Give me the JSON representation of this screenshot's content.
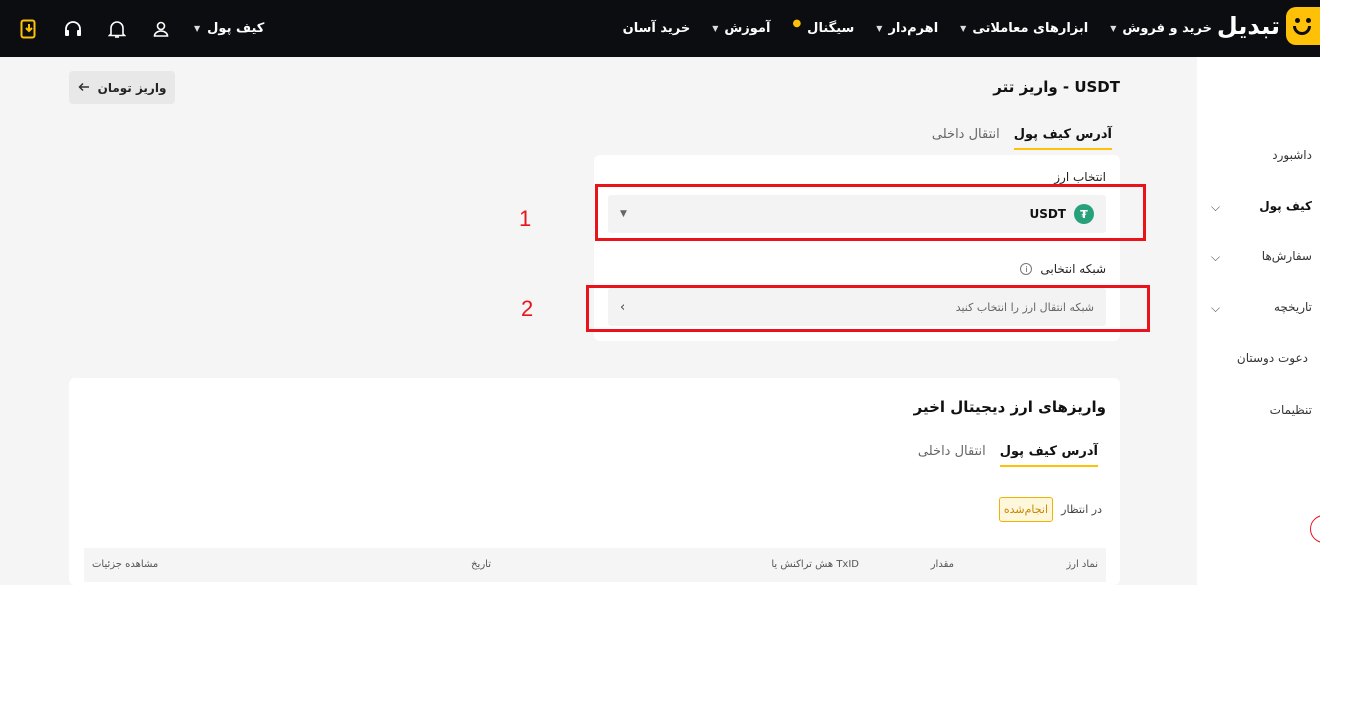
{
  "header": {
    "logo_text": "تبدیل",
    "nav": [
      {
        "label": "خرید و فروش",
        "has_dropdown": true
      },
      {
        "label": "ابزارهای معاملاتی",
        "has_dropdown": true
      },
      {
        "label": "اهرم‌دار",
        "has_dropdown": true
      },
      {
        "label": "سیگنال",
        "has_dropdown": false
      },
      {
        "label": "آموزش",
        "has_dropdown": true
      },
      {
        "label": "خرید آسان",
        "has_dropdown": false
      }
    ],
    "wallet_label": "کیف پول",
    "icons": [
      "user-icon",
      "bell-icon",
      "headset-icon",
      "download-app-icon"
    ]
  },
  "sidebar": {
    "items": [
      {
        "label": "داشبورد",
        "expandable": false
      },
      {
        "label": "کیف پول",
        "expandable": true,
        "active": true
      },
      {
        "label": "سفارش‌ها",
        "expandable": true
      },
      {
        "label": "تاریخچه",
        "expandable": true
      },
      {
        "label": "دعوت دوستان",
        "expandable": false
      },
      {
        "label": "تنظیمات",
        "expandable": false
      }
    ]
  },
  "page": {
    "title": "واریز تتر - USDT",
    "back_button": "واریز تومان",
    "tabs": [
      {
        "label": "آدرس کیف پول",
        "active": true
      },
      {
        "label": "انتقال داخلی",
        "active": false
      }
    ]
  },
  "form": {
    "currency_label": "انتخاب ارز",
    "currency_value": "USDT",
    "network_label": "شبکه انتخابی",
    "network_placeholder": "شبکه انتقال ارز را انتخاب کنید"
  },
  "annotations": {
    "first": "1",
    "second": "2",
    "color": "#e8131b"
  },
  "recent": {
    "title": "واریزهای ارز دیجیتال اخیر",
    "tabs": [
      {
        "label": "آدرس کیف پول",
        "active": true
      },
      {
        "label": "انتقال داخلی",
        "active": false
      }
    ],
    "filters": {
      "pending": "در انتظار",
      "done": "انجام‌شده"
    },
    "columns": [
      "نماد ارز",
      "مقدار",
      "هش تراکنش یا TxID",
      "تاریخ",
      "مشاهده جزئیات"
    ]
  },
  "colors": {
    "accent": "#ffc107",
    "topbar": "#0b0d10",
    "usdt": "#26a17b"
  }
}
